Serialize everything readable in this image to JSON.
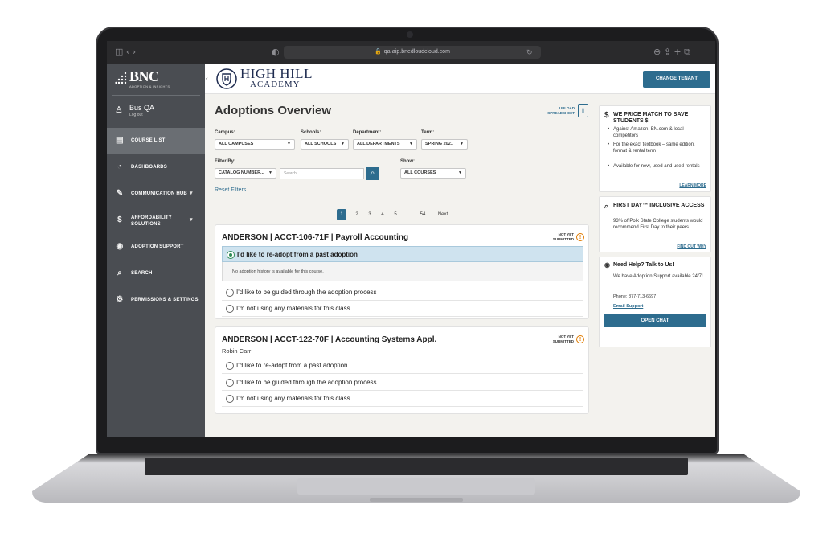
{
  "browser": {
    "url": "qa-aip.bnedloudcloud.com",
    "left_controls": "◫  ‹  ›",
    "right_controls": "⊕  ⇪  +  ⧉"
  },
  "brand": {
    "logo": "BNC",
    "tagline": "ADOPTION & INSIGHTS"
  },
  "user": {
    "name": "Bus QA",
    "logout": "Log out"
  },
  "nav": [
    {
      "label": "COURSE LIST",
      "active": true
    },
    {
      "label": "DASHBOARDS"
    },
    {
      "label": "COMMUNICATION HUB"
    },
    {
      "label": "AFFORDABILITY SOLUTIONS"
    },
    {
      "label": "ADOPTION SUPPORT"
    },
    {
      "label": "SEARCH"
    },
    {
      "label": "PERMISSIONS & SETTINGS"
    }
  ],
  "header": {
    "school_name": "HIGH HILL",
    "school_sub": "ACADEMY",
    "change_tenant": "CHANGE TENANT"
  },
  "page": {
    "title": "Adoptions Overview",
    "upload_line1": "UPLOAD",
    "upload_line2": "SPREADSHEET"
  },
  "filters": {
    "campus_label": "Campus:",
    "campus_value": "ALL CAMPUSES",
    "schools_label": "Schools:",
    "schools_value": "ALL SCHOOLS",
    "department_label": "Department:",
    "department_value": "ALL DEPARTMENTS",
    "term_label": "Term:",
    "term_value": "SPRING 2021",
    "filterby_label": "Filter By:",
    "filterby_value": "CATALOG NUMBER...",
    "search_placeholder": "Search",
    "show_label": "Show:",
    "show_value": "ALL COURSES",
    "reset": "Reset Filters"
  },
  "pagination": {
    "pages": [
      "1",
      "2",
      "3",
      "4",
      "5",
      "...",
      "54"
    ],
    "next": "Next",
    "current": "1"
  },
  "courses": [
    {
      "title": "ANDERSON | ACCT-106-71F | Payroll Accounting",
      "status_line1": "NOT YET",
      "status_line2": "SUBMITTED",
      "options": [
        "I'd like to re-adopt from a past adoption",
        "I'd like to be guided through the adoption process",
        "I'm not using any materials for this class"
      ],
      "history": "No adoption history is available for this course."
    },
    {
      "title": "ANDERSON | ACCT-122-70F | Accounting Systems Appl.",
      "instructor": "Robin Carr",
      "status_line1": "NOT YET",
      "status_line2": "SUBMITTED",
      "options": [
        "I'd like to re-adopt from a past adoption",
        "I'd like to be guided through the adoption process",
        "I'm not using any materials for this class"
      ]
    }
  ],
  "panels": {
    "price": {
      "title": "WE PRICE MATCH TO SAVE STUDENTS $",
      "bullets": [
        "Against Amazon, BN.com & local competitors",
        "For the exact textbook – same edition, format & rental term",
        "Available for new, used and used rentals"
      ],
      "link": "LEARN MORE"
    },
    "firstday": {
      "title": "FIRST DAY™ INCLUSIVE ACCESS",
      "text": "93% of Polk State College students would recommend First Day to their peers",
      "link": "FIND OUT WHY"
    },
    "help": {
      "title": "Need Help? Talk to Us!",
      "text": "We have Adoption Support available 24/7!",
      "phone": "Phone: 877-713-6697",
      "email": "Email Support",
      "button": "OPEN CHAT"
    }
  }
}
